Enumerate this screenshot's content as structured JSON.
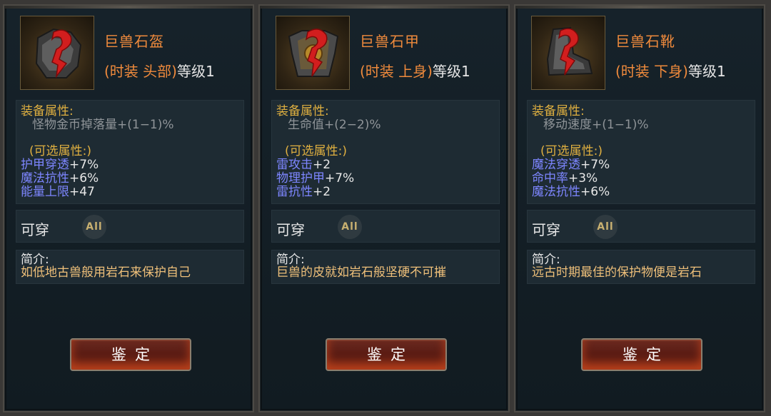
{
  "panels": [
    {
      "icon": "helmet-icon",
      "name": "巨兽石盔",
      "type_open": "(时装 头部)",
      "type_level": "等级1",
      "attr_label": "装备属性:",
      "attr_value": "怪物金币掉落量+(1−1)%",
      "optional_label": "(可选属性:)",
      "optional_stats": [
        {
          "name": "护甲穿透",
          "value": "+7%"
        },
        {
          "name": "魔法抗性",
          "value": "+6%"
        },
        {
          "name": "能量上限",
          "value": "+47"
        }
      ],
      "wear_label": "可穿",
      "wear_badge": "All",
      "intro_label": "简介:",
      "intro_text": "如低地古兽般用岩石来保护自己",
      "button_label": "鉴定"
    },
    {
      "icon": "armor-icon",
      "name": "巨兽石甲",
      "type_open": "(时装 上身)",
      "type_level": "等级1",
      "attr_label": "装备属性:",
      "attr_value": "生命值+(2−2)%",
      "optional_label": "(可选属性:)",
      "optional_stats": [
        {
          "name": "雷攻击",
          "value": "+2"
        },
        {
          "name": "物理护甲",
          "value": "+7%"
        },
        {
          "name": "雷抗性",
          "value": "+2"
        }
      ],
      "wear_label": "可穿",
      "wear_badge": "All",
      "intro_label": "简介:",
      "intro_text": "巨兽的皮就如岩石般坚硬不可摧",
      "button_label": "鉴定"
    },
    {
      "icon": "boots-icon",
      "name": "巨兽石靴",
      "type_open": "(时装 下身)",
      "type_level": "等级1",
      "attr_label": "装备属性:",
      "attr_value": "移动速度+(1−1)%",
      "optional_label": "(可选属性:)",
      "optional_stats": [
        {
          "name": "魔法穿透",
          "value": "+7%"
        },
        {
          "name": "命中率",
          "value": "+3%"
        },
        {
          "name": "魔法抗性",
          "value": "+6%"
        }
      ],
      "wear_label": "可穿",
      "wear_badge": "All",
      "intro_label": "简介:",
      "intro_text": "远古时期最佳的保护物便是岩石",
      "button_label": "鉴定"
    }
  ]
}
